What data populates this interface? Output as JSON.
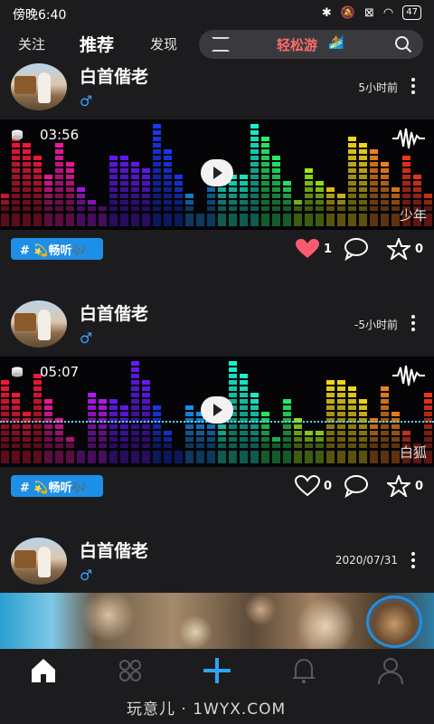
{
  "status_bar": {
    "time": "傍晚6:40",
    "battery": "47"
  },
  "top_nav": {
    "tabs": [
      {
        "label": "关注"
      },
      {
        "label": "推荐"
      },
      {
        "label": "发现"
      }
    ],
    "search_text": "轻松游",
    "search_emoji": "🏄"
  },
  "posts": [
    {
      "user": "白首偕老",
      "gender": "♂",
      "time": "5小时前",
      "duration": "03:56",
      "song": "少年",
      "tag": "# 💫畅听🎶",
      "likes": "1",
      "liked": true,
      "stars": "0"
    },
    {
      "user": "白首偕老",
      "gender": "♂",
      "time": "-5小时前",
      "duration": "05:07",
      "song": "白狐",
      "tag": "# 💫畅听🎶",
      "likes": "0",
      "liked": false,
      "stars": "0"
    },
    {
      "user": "白首偕老",
      "gender": "♂",
      "time": "2020/07/31"
    }
  ],
  "colors": {
    "accent": "#1e8fe6",
    "like": "#ff5a6e",
    "search_text": "#ff6b6b",
    "background": "#1c1c1e"
  },
  "icons": [
    "home-icon",
    "discover-grid-icon",
    "add-icon",
    "bell-icon",
    "profile-icon"
  ],
  "watermark": "玩意儿 · 1WYX.COM"
}
